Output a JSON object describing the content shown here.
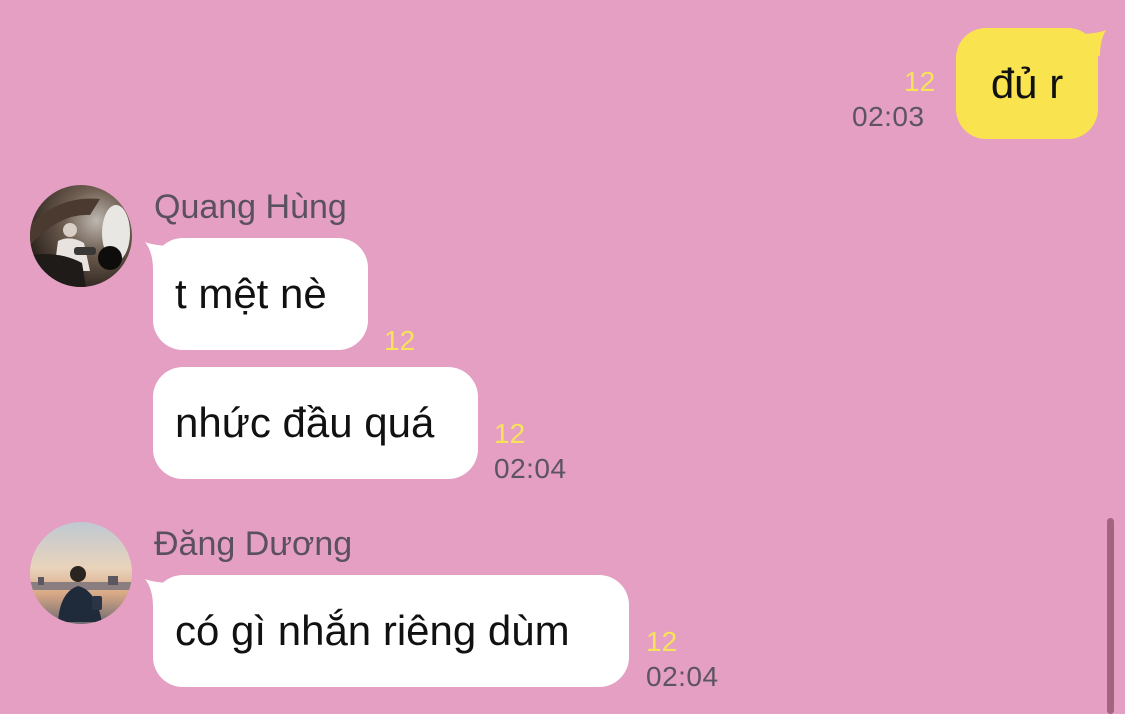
{
  "messages": [
    {
      "sender": "",
      "text": "đủ r",
      "unread": "12",
      "time": "02:03",
      "outgoing": true
    },
    {
      "sender": "Quang Hùng",
      "text": "t mệt nè",
      "unread": "12",
      "time": ""
    },
    {
      "sender": "",
      "text": "nhức đầu quá",
      "unread": "12",
      "time": "02:04"
    },
    {
      "sender": "Đăng Dương",
      "text": "có gì nhắn riêng dùm",
      "unread": "12",
      "time": "02:04"
    }
  ],
  "colors": {
    "background": "#e49fc2",
    "incoming_bubble": "#ffffff",
    "outgoing_bubble": "#f9e34f",
    "unread_count": "#f7e35a",
    "timestamp": "#5c5460"
  }
}
